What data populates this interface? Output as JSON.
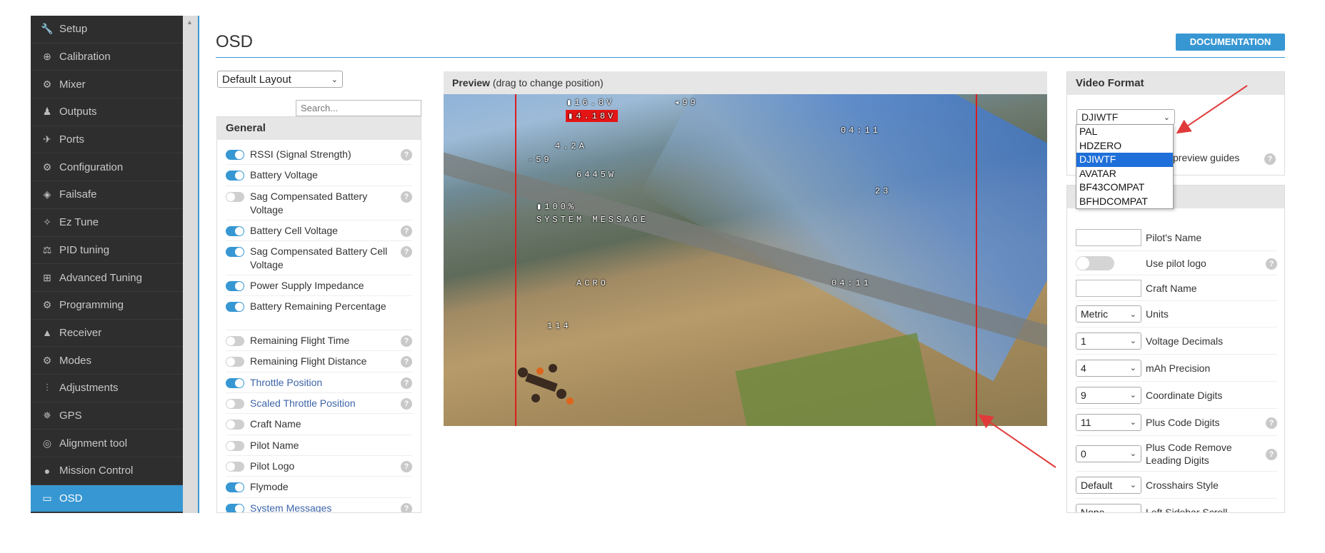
{
  "sidebar": {
    "items": [
      {
        "label": "Setup",
        "icon": "🔧",
        "name": "wrench-icon"
      },
      {
        "label": "Calibration",
        "icon": "⊕",
        "name": "crosshair-icon"
      },
      {
        "label": "Mixer",
        "icon": "⚙",
        "name": "mixer-icon"
      },
      {
        "label": "Outputs",
        "icon": "♟",
        "name": "outputs-icon"
      },
      {
        "label": "Ports",
        "icon": "✈",
        "name": "ports-icon"
      },
      {
        "label": "Configuration",
        "icon": "⚙",
        "name": "gear-icon"
      },
      {
        "label": "Failsafe",
        "icon": "◈",
        "name": "failsafe-icon"
      },
      {
        "label": "Ez Tune",
        "icon": "✧",
        "name": "magic-wand-icon"
      },
      {
        "label": "PID tuning",
        "icon": "⚖",
        "name": "sitemap-icon"
      },
      {
        "label": "Advanced Tuning",
        "icon": "⊞",
        "name": "advanced-tuning-icon"
      },
      {
        "label": "Programming",
        "icon": "⚙",
        "name": "programming-gear-icon"
      },
      {
        "label": "Receiver",
        "icon": "▲",
        "name": "receiver-icon"
      },
      {
        "label": "Modes",
        "icon": "⚙",
        "name": "modes-icon"
      },
      {
        "label": "Adjustments",
        "icon": "⫶",
        "name": "sliders-icon"
      },
      {
        "label": "GPS",
        "icon": "✵",
        "name": "satellite-icon"
      },
      {
        "label": "Alignment tool",
        "icon": "◎",
        "name": "compass-icon"
      },
      {
        "label": "Mission Control",
        "icon": "●",
        "name": "map-marker-icon"
      },
      {
        "label": "OSD",
        "icon": "▭",
        "name": "osd-icon"
      }
    ],
    "active": "OSD"
  },
  "header": {
    "title": "OSD",
    "doc_button": "DOCUMENTATION"
  },
  "layout_select": {
    "value": "Default Layout"
  },
  "search": {
    "placeholder": "Search..."
  },
  "general": {
    "title": "General",
    "items": [
      {
        "label": "RSSI (Signal Strength)",
        "on": true,
        "help": true
      },
      {
        "label": "Battery Voltage",
        "on": true,
        "help": false
      },
      {
        "label": "Sag Compensated Battery Voltage",
        "on": false,
        "help": true
      },
      {
        "label": "Battery Cell Voltage",
        "on": true,
        "help": true
      },
      {
        "label": "Sag Compensated Battery Cell Voltage",
        "on": true,
        "help": true
      },
      {
        "label": "Power Supply Impedance",
        "on": true,
        "help": false
      },
      {
        "label": "Battery Remaining Percentage",
        "on": true,
        "help": false
      },
      {
        "label": "Remaining Flight Time",
        "on": false,
        "help": true
      },
      {
        "label": "Remaining Flight Distance",
        "on": false,
        "help": true
      },
      {
        "label": "Throttle Position",
        "on": true,
        "help": true
      },
      {
        "label": "Scaled Throttle Position",
        "on": false,
        "help": true
      },
      {
        "label": "Craft Name",
        "on": false,
        "help": false
      },
      {
        "label": "Pilot Name",
        "on": false,
        "help": false
      },
      {
        "label": "Pilot Logo",
        "on": false,
        "help": true
      },
      {
        "label": "Flymode",
        "on": true,
        "help": false
      },
      {
        "label": "System Messages",
        "on": true,
        "help": true
      }
    ]
  },
  "preview": {
    "title": "Preview",
    "subtitle": "(drag to change position)",
    "osd": {
      "voltage": "16.8V",
      "cell": "4.18V",
      "rssi": "99",
      "current": "4.2A",
      "mah": "-59",
      "power": "6445W",
      "battery_pct": "100%",
      "system_message": "SYSTEM MESSAGE",
      "time1": "04:11",
      "time2": "04:11",
      "altitude": "23",
      "flymode": "ACRO",
      "speed": "114"
    }
  },
  "video_format": {
    "title": "Video Format",
    "value": "DJIWTF",
    "options": [
      "PAL",
      "HDZERO",
      "DJIWTF",
      "AVATAR",
      "BF43COMPAT",
      "BFHDCOMPAT"
    ],
    "guides_label": "preview guides"
  },
  "settings": {
    "pilot_name_label": "Pilot's Name",
    "use_pilot_logo_label": "Use pilot logo",
    "craft_name_label": "Craft Name",
    "units": {
      "value": "Metric",
      "label": "Units"
    },
    "voltage_decimals": {
      "value": "1",
      "label": "Voltage Decimals"
    },
    "mah_precision": {
      "value": "4",
      "label": "mAh Precision"
    },
    "coordinate_digits": {
      "value": "9",
      "label": "Coordinate Digits"
    },
    "plus_code_digits": {
      "value": "11",
      "label": "Plus Code Digits"
    },
    "plus_code_remove": {
      "value": "0",
      "label": "Plus Code Remove Leading Digits"
    },
    "crosshairs_style": {
      "value": "Default",
      "label": "Crosshairs Style"
    },
    "left_sidebar_scroll": {
      "value": "None",
      "label": "Left Sidebar Scroll"
    }
  },
  "colors": {
    "accent": "#3797d3",
    "osd_guide": "#d81f1f",
    "annotation_arrow": "#e03a3a"
  }
}
